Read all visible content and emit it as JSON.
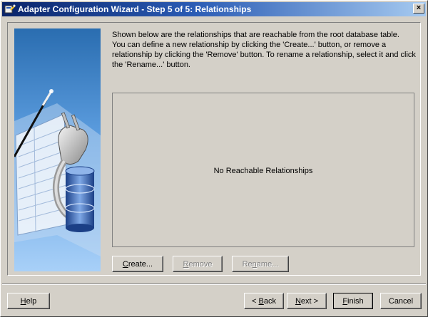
{
  "window": {
    "title": "Adapter Configuration Wizard - Step 5 of 5: Relationships",
    "close_label": "×"
  },
  "description": {
    "lines": [
      "Shown below are the relationships that are reachable from the root database table.",
      "You can define a new relationship by clicking the 'Create...' button, or remove a",
      "relationship by clicking the 'Remove' button.  To rename a relationship, select it and click",
      "the 'Rename...' button."
    ]
  },
  "relationships": {
    "empty_message": "No Reachable Relationships",
    "items": []
  },
  "actions": {
    "create": {
      "prefix": "",
      "mnemonic": "C",
      "suffix": "reate...",
      "enabled": true
    },
    "remove": {
      "prefix": "",
      "mnemonic": "R",
      "suffix": "emove",
      "enabled": false
    },
    "rename": {
      "prefix": "Re",
      "mnemonic": "n",
      "suffix": "ame...",
      "enabled": false
    }
  },
  "footer": {
    "help": {
      "prefix": "",
      "mnemonic": "H",
      "suffix": "elp"
    },
    "back": {
      "prefix": "< ",
      "mnemonic": "B",
      "suffix": "ack"
    },
    "next": {
      "prefix": "",
      "mnemonic": "N",
      "suffix": "ext >"
    },
    "finish": {
      "prefix": "",
      "mnemonic": "F",
      "suffix": "inish"
    },
    "cancel": {
      "prefix": "Cancel",
      "mnemonic": "",
      "suffix": ""
    }
  },
  "colors": {
    "titlebar_start": "#0a246a",
    "titlebar_end": "#a6caf0",
    "dialog_face": "#d4d0c8",
    "side_panel_top": "#2a6db0",
    "side_panel_bottom": "#a8d0f8"
  }
}
